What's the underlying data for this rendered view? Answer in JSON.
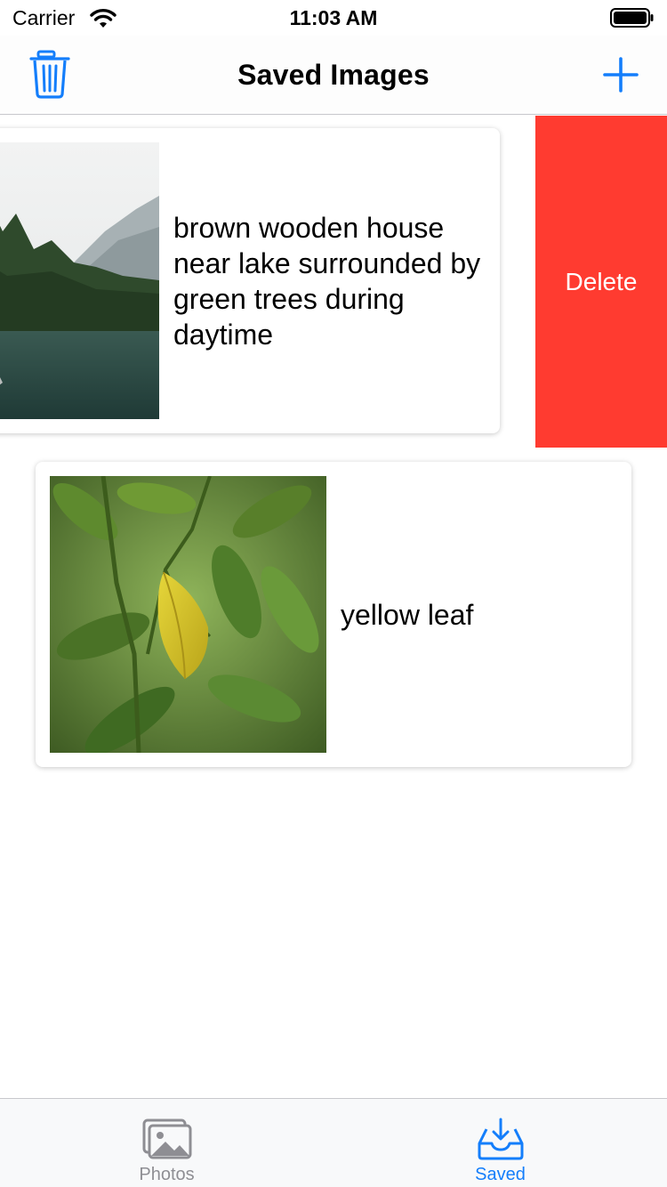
{
  "status_bar": {
    "carrier": "Carrier",
    "time": "11:03 AM"
  },
  "nav": {
    "title": "Saved Images",
    "left_icon": "trash-icon",
    "right_icon": "plus-icon",
    "accent_color": "#147efb"
  },
  "saved_items": [
    {
      "caption": "brown wooden house near lake surrounded by green trees during daytime",
      "swipe_action_label": "Delete"
    },
    {
      "caption": "yellow leaf"
    }
  ],
  "delete_color": "#ff3b30",
  "tabs": [
    {
      "label": "Photos",
      "icon": "photos-icon",
      "selected": false
    },
    {
      "label": "Saved",
      "icon": "tray-download-icon",
      "selected": true
    }
  ]
}
